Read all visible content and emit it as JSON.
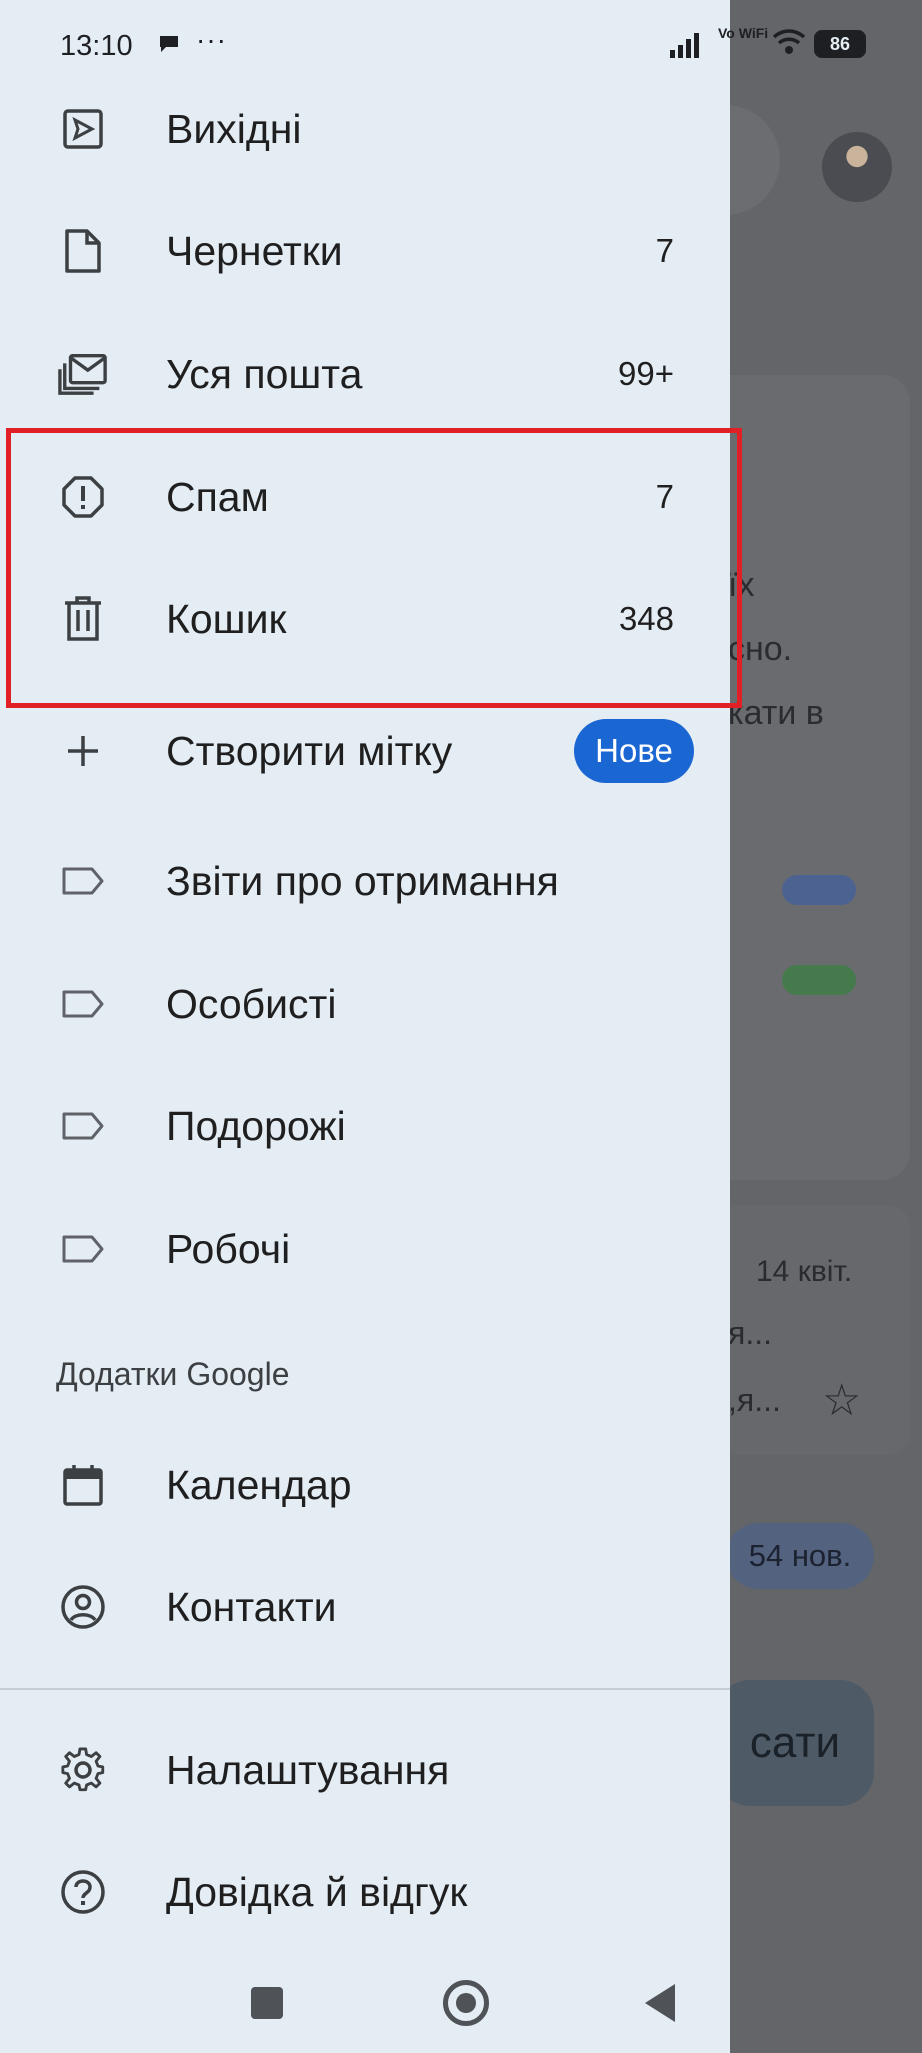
{
  "status_bar": {
    "time": "13:10",
    "dots": "···",
    "network_label": "Vo WiFi",
    "battery": "86"
  },
  "drawer": {
    "items_top": [
      {
        "label": "Вихідні",
        "count": "",
        "icon": "sent-icon"
      },
      {
        "label": "Чернетки",
        "count": "7",
        "icon": "draft-icon"
      },
      {
        "label": "Уся пошта",
        "count": "99+",
        "icon": "all-mail-icon"
      },
      {
        "label": "Спам",
        "count": "7",
        "icon": "spam-icon"
      },
      {
        "label": "Кошик",
        "count": "348",
        "icon": "trash-icon"
      }
    ],
    "create_label": {
      "label": "Створити мітку",
      "badge": "Нове"
    },
    "labels": [
      {
        "label": "Звіти про отримання"
      },
      {
        "label": "Особисті"
      },
      {
        "label": "Подорожі"
      },
      {
        "label": "Робочі"
      }
    ],
    "apps_section_title": "Додатки Google",
    "apps": [
      {
        "label": "Календар",
        "icon": "calendar-icon"
      },
      {
        "label": "Контакти",
        "icon": "contacts-icon"
      }
    ],
    "footer": [
      {
        "label": "Налаштування",
        "icon": "settings-icon"
      },
      {
        "label": "Довідка й відгук",
        "icon": "help-icon"
      }
    ]
  },
  "background": {
    "card_lines": [
      "їх",
      "сно.",
      "кати в"
    ],
    "date": "14 квіт.",
    "snippets": [
      "я...",
      ",я..."
    ],
    "new_count": "54 нов.",
    "compose_partial": "сати"
  },
  "colors": {
    "drawer_bg": "#e4ecf4",
    "highlight_border": "#e01f26",
    "badge_bg": "#1a66d2",
    "chip_blue": "#4c6391",
    "chip_green": "#457a4d"
  }
}
